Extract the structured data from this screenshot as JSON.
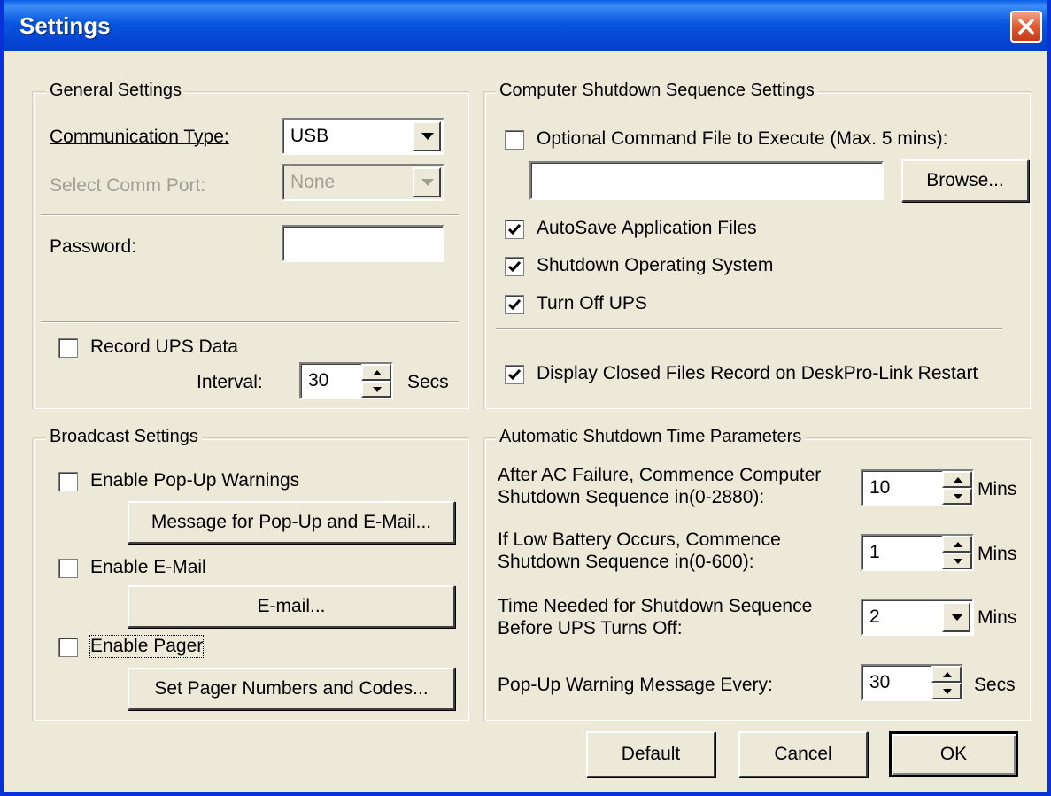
{
  "window": {
    "title": "Settings",
    "close_icon": "close-icon",
    "accent": "#0831d9",
    "close_color": "#e05a32"
  },
  "general": {
    "legend": "General Settings",
    "comm_type_label": "Communication Type:",
    "comm_type_value": "USB",
    "comm_port_label": "Select Comm Port:",
    "comm_port_value": "None",
    "password_label": "Password:",
    "password_value": "",
    "record_label": "Record UPS Data",
    "record_checked": false,
    "interval_label": "Interval:",
    "interval_value": "30",
    "interval_unit": "Secs"
  },
  "broadcast": {
    "legend": "Broadcast Settings",
    "popup_label": "Enable Pop-Up Warnings",
    "popup_checked": false,
    "message_button": "Message for Pop-Up and E-Mail...",
    "email_label": "Enable E-Mail",
    "email_checked": false,
    "email_button": "E-mail...",
    "pager_label": "Enable Pager",
    "pager_checked": false,
    "pager_button": "Set Pager Numbers and Codes..."
  },
  "shutdown": {
    "legend": "Computer Shutdown Sequence Settings",
    "command_label": "Optional Command File to Execute (Max. 5 mins):",
    "command_checked": false,
    "command_value": "",
    "browse_button": "Browse...",
    "autosave_label": "AutoSave Application Files",
    "autosave_checked": true,
    "shutdown_os_label": "Shutdown Operating System",
    "shutdown_os_checked": true,
    "turnoff_label": "Turn Off UPS",
    "turnoff_checked": true,
    "display_label": "Display Closed Files Record on DeskPro-Link Restart",
    "display_checked": true
  },
  "auto": {
    "legend": "Automatic Shutdown Time Parameters",
    "ac_line1": "After AC Failure, Commence Computer",
    "ac_line2": "Shutdown Sequence in(0-2880):",
    "ac_value": "10",
    "ac_unit": "Mins",
    "low_line1": "If Low Battery Occurs, Commence",
    "low_line2": "Shutdown Sequence in(0-600):",
    "low_value": "1",
    "low_unit": "Mins",
    "time_line1": "Time Needed for Shutdown Sequence",
    "time_line2": "Before UPS Turns Off:",
    "time_value": "2",
    "time_unit": "Mins",
    "popup_label": "Pop-Up Warning Message Every:",
    "popup_value": "30",
    "popup_unit": "Secs"
  },
  "footer": {
    "default_button": "Default",
    "cancel_button": "Cancel",
    "ok_button": "OK"
  }
}
